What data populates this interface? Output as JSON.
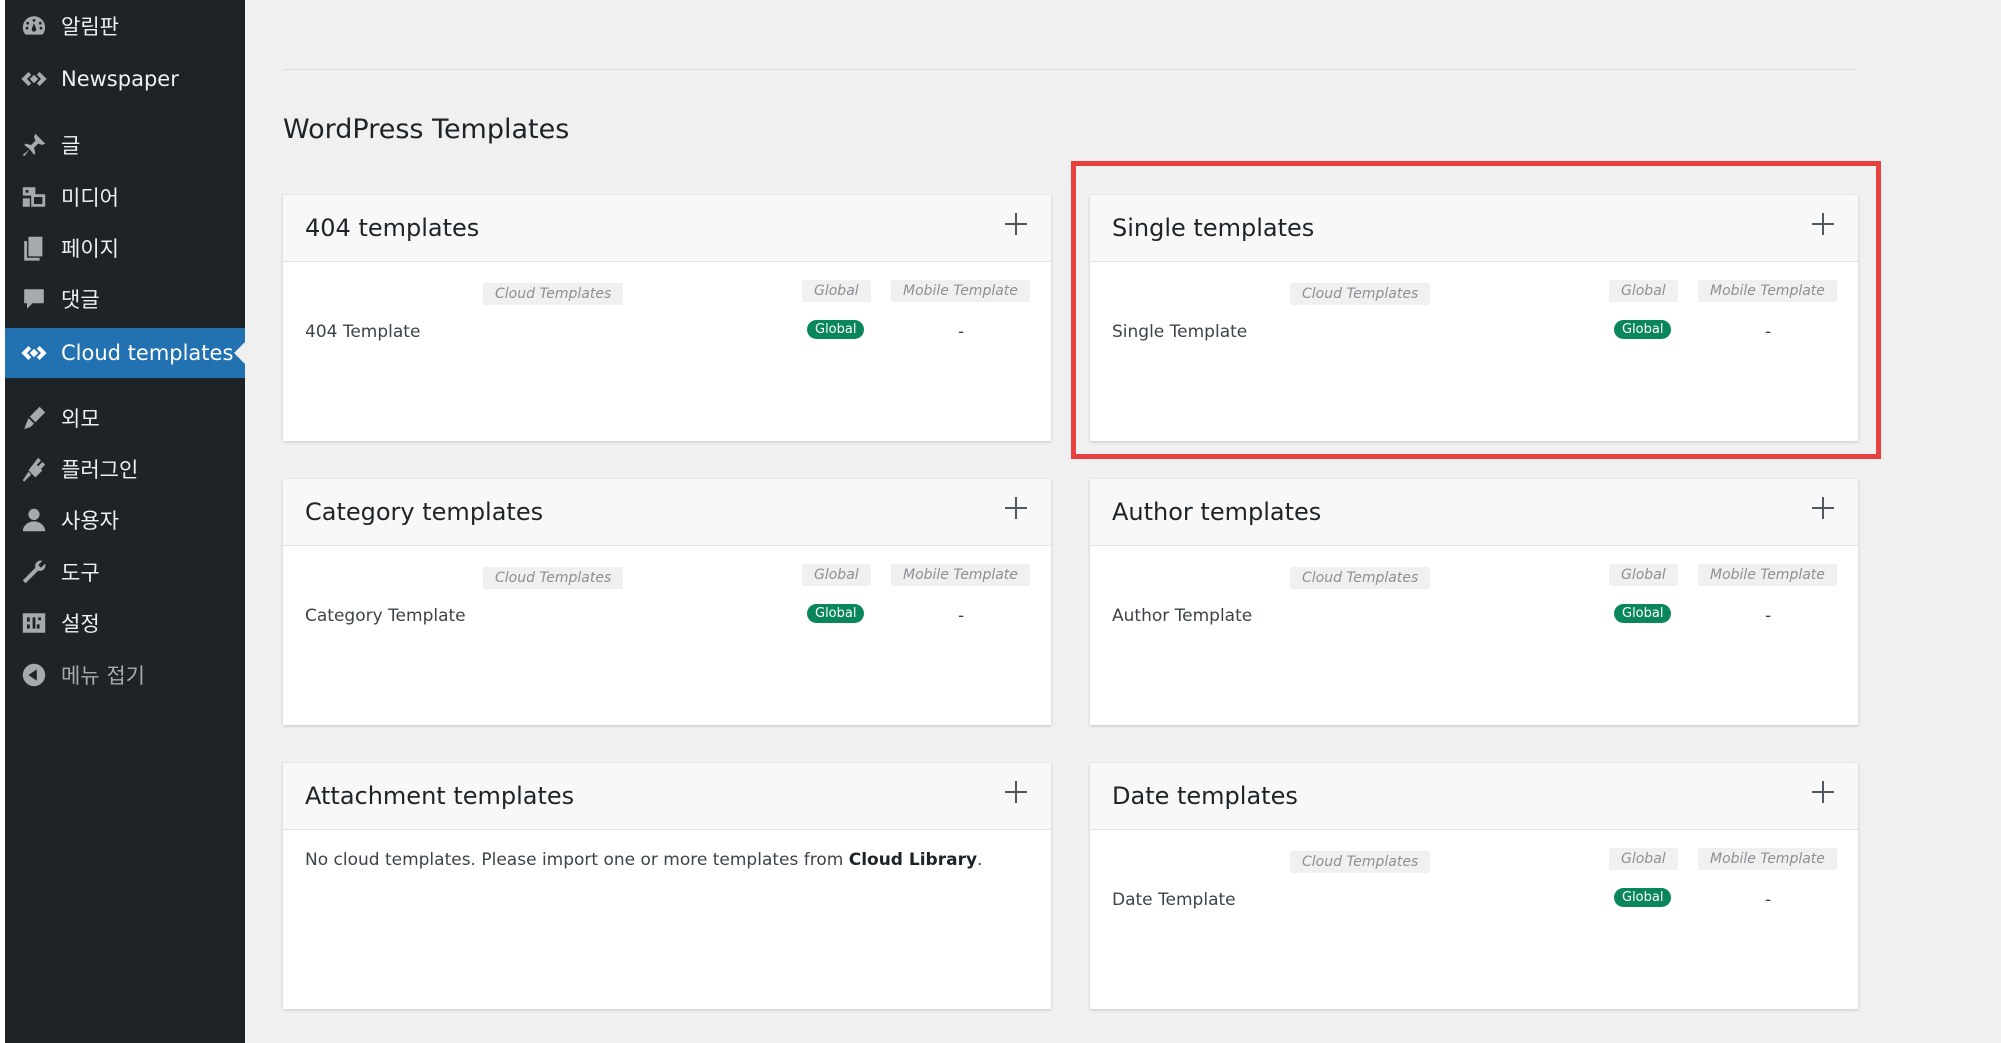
{
  "sidebar": {
    "items": [
      {
        "label": "알림판",
        "icon": "dashboard-icon"
      },
      {
        "label": "Newspaper",
        "icon": "newspaper-logo-icon"
      },
      {
        "label": "글",
        "icon": "pin-icon"
      },
      {
        "label": "미디어",
        "icon": "media-icon"
      },
      {
        "label": "페이지",
        "icon": "page-icon"
      },
      {
        "label": "댓글",
        "icon": "comment-icon"
      },
      {
        "label": "Cloud templates",
        "icon": "cloud-templates-icon"
      },
      {
        "label": "외모",
        "icon": "appearance-brush-icon"
      },
      {
        "label": "플러그인",
        "icon": "plugin-icon"
      },
      {
        "label": "사용자",
        "icon": "user-icon"
      },
      {
        "label": "도구",
        "icon": "wrench-icon"
      },
      {
        "label": "설정",
        "icon": "settings-icon"
      },
      {
        "label": "메뉴 접기",
        "icon": "collapse-arrow-icon"
      }
    ],
    "active_index": 6
  },
  "main": {
    "title": "WordPress Templates",
    "cards": [
      {
        "title": "404 templates",
        "headers": {
          "cloud": "Cloud Templates",
          "global": "Global",
          "mobile": "Mobile Template"
        },
        "rows": [
          {
            "name": "404 Template",
            "global": "Global",
            "mobile": "-"
          }
        ]
      },
      {
        "title": "Single templates",
        "highlighted": true,
        "headers": {
          "cloud": "Cloud Templates",
          "global": "Global",
          "mobile": "Mobile Template"
        },
        "rows": [
          {
            "name": "Single Template",
            "global": "Global",
            "mobile": "-"
          }
        ]
      },
      {
        "title": "Category templates",
        "headers": {
          "cloud": "Cloud Templates",
          "global": "Global",
          "mobile": "Mobile Template"
        },
        "rows": [
          {
            "name": "Category Template",
            "global": "Global",
            "mobile": "-"
          }
        ]
      },
      {
        "title": "Author templates",
        "headers": {
          "cloud": "Cloud Templates",
          "global": "Global",
          "mobile": "Mobile Template"
        },
        "rows": [
          {
            "name": "Author Template",
            "global": "Global",
            "mobile": "-"
          }
        ]
      },
      {
        "title": "Attachment templates",
        "empty_message": "No cloud templates. Please import one or more templates from ",
        "empty_link": "Cloud Library",
        "empty_suffix": "."
      },
      {
        "title": "Date templates",
        "headers": {
          "cloud": "Cloud Templates",
          "global": "Global",
          "mobile": "Mobile Template"
        },
        "rows": [
          {
            "name": "Date Template",
            "global": "Global",
            "mobile": "-"
          }
        ]
      }
    ]
  },
  "colors": {
    "sidebar_bg": "#1d2327",
    "active_menu": "#2271b1",
    "global_badge": "#0a875a",
    "highlight_border": "#e8403f"
  }
}
